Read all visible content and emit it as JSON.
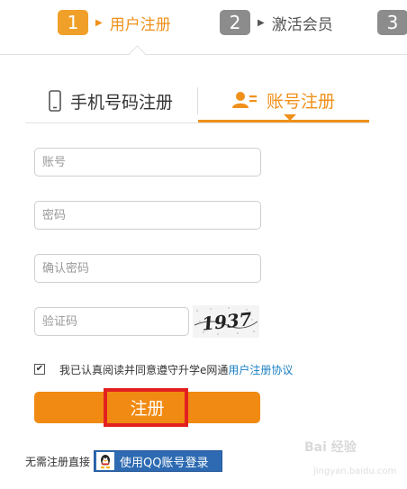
{
  "steps": [
    {
      "num": "1",
      "label": "用户注册"
    },
    {
      "num": "2",
      "label": "激活会员"
    },
    {
      "num": "3"
    }
  ],
  "tabs": {
    "phone": "手机号码注册",
    "account": "账号注册",
    "active": "account"
  },
  "form": {
    "account_placeholder": "账号",
    "password_placeholder": "密码",
    "confirm_placeholder": "确认密码",
    "captcha_placeholder": "验证码",
    "captcha_text": "1937"
  },
  "agreement": {
    "checked": true,
    "text": "我已认真阅读并同意遵守升学e网通",
    "link": "用户注册协议"
  },
  "register_button": "注册",
  "qq": {
    "prefix": "无需注册直接",
    "button": "使用QQ账号登录"
  },
  "watermark": {
    "logo": "Bai 经验",
    "url": "jingyan.baidu.com"
  },
  "colors": {
    "accent": "#f08a12",
    "link": "#1a7fc4",
    "highlight": "#e32020",
    "qq_blue": "#2d6ab2"
  }
}
